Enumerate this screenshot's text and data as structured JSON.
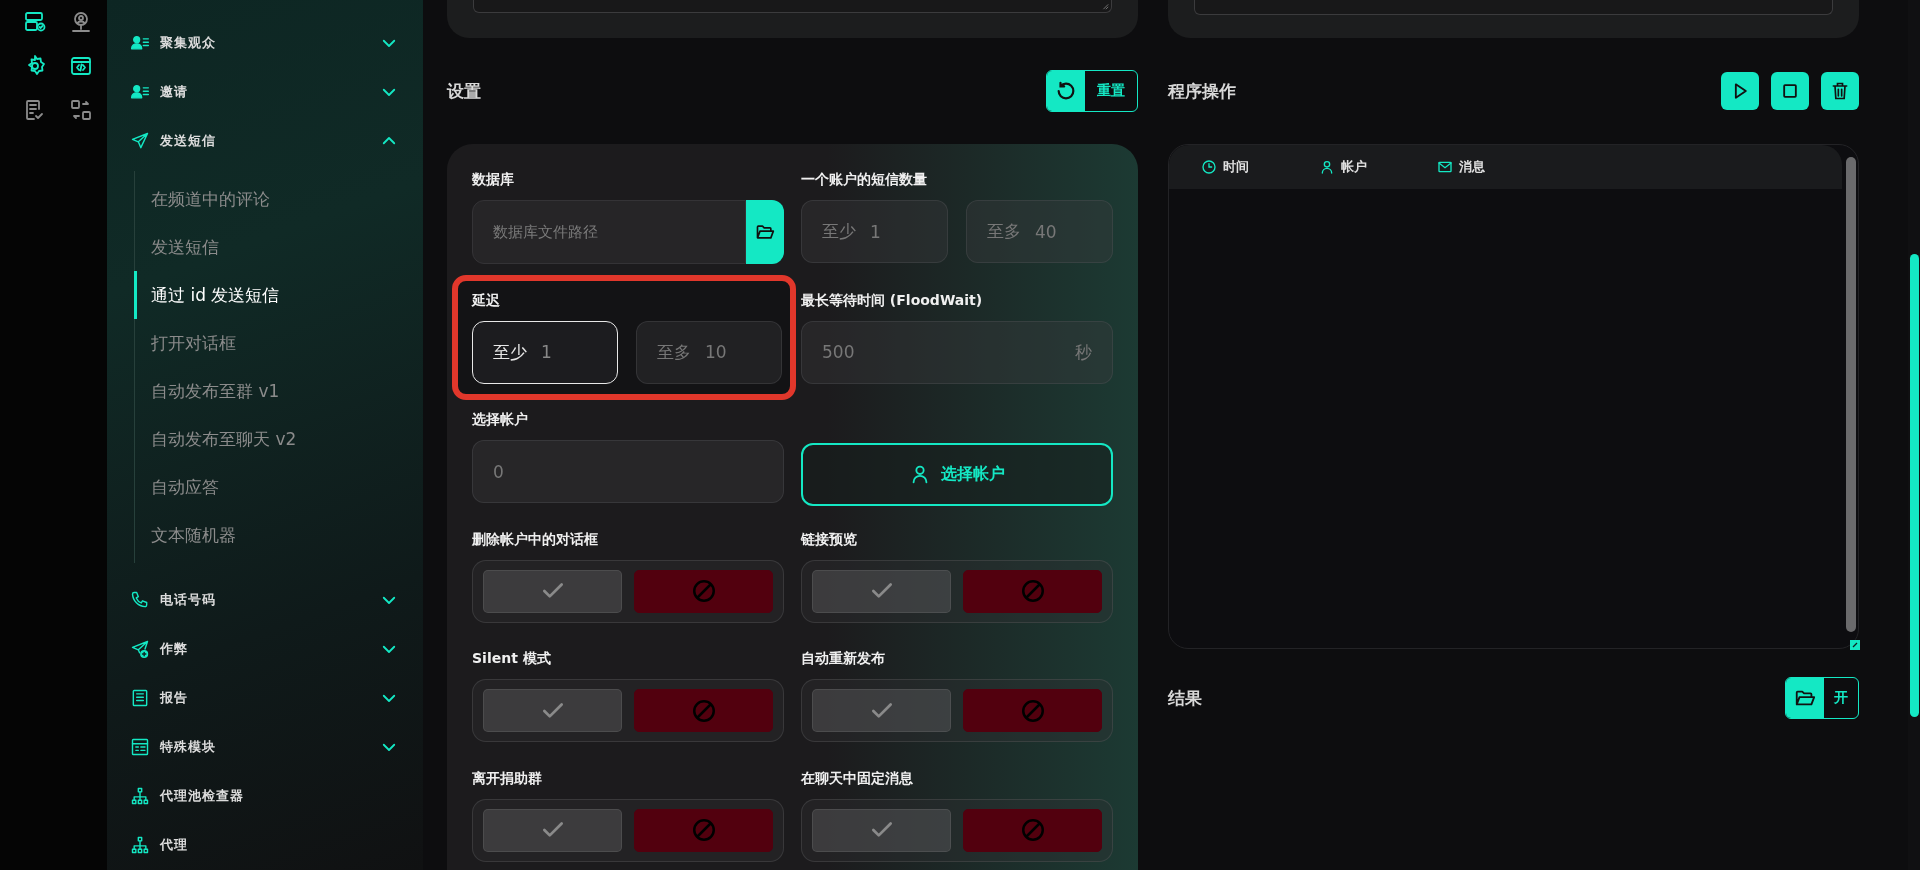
{
  "rail": [
    {
      "active": true
    },
    {
      "active": false
    },
    {
      "active": true
    },
    {
      "active": true
    },
    {
      "active": false
    },
    {
      "active": false
    }
  ],
  "sidebar": {
    "groups": [
      {
        "label": "聚集观众",
        "expanded": false
      },
      {
        "label": "邀请",
        "expanded": false
      },
      {
        "label": "发送短信",
        "expanded": true,
        "children": [
          {
            "label": "在频道中的评论",
            "selected": false
          },
          {
            "label": "发送短信",
            "selected": false
          },
          {
            "label": "通过 id 发送短信",
            "selected": true
          },
          {
            "label": "打开对话框",
            "selected": false
          },
          {
            "label": "自动发布至群 v1",
            "selected": false
          },
          {
            "label": "自动发布至聊天 v2",
            "selected": false
          },
          {
            "label": "自动应答",
            "selected": false
          },
          {
            "label": "文本随机器",
            "selected": false
          }
        ]
      },
      {
        "label": "电话号码",
        "expanded": false
      },
      {
        "label": "作弊",
        "expanded": false
      },
      {
        "label": "报告",
        "expanded": false
      },
      {
        "label": "特殊模块",
        "expanded": false
      },
      {
        "label": "代理池检查器"
      },
      {
        "label": "代理"
      }
    ]
  },
  "settings": {
    "title": "设置",
    "reset_button": "重置",
    "database": {
      "label": "数据库",
      "placeholder": "数据库文件路径"
    },
    "messages_per_account": {
      "label": "一个账户的短信数量",
      "min": {
        "prefix": "至少",
        "value": "1",
        "focused": false
      },
      "max": {
        "prefix": "至多",
        "value": "40",
        "focused": false
      }
    },
    "delay": {
      "label": "延迟",
      "highlighted": true,
      "min": {
        "prefix": "至少",
        "value": "1",
        "focused": true
      },
      "max": {
        "prefix": "至多",
        "value": "10",
        "focused": false
      }
    },
    "flood_wait": {
      "label": "最长等待时间 (FloodWait)",
      "value": "500",
      "suffix": "秒"
    },
    "accounts": {
      "label": "选择帐户",
      "value": "0",
      "button": "选择帐户"
    },
    "toggles": [
      {
        "label": "删除帐户中的对话框",
        "on": false
      },
      {
        "label": "链接预览",
        "on": false
      },
      {
        "label": "Silent 模式",
        "on": false
      },
      {
        "label": "自动重新发布",
        "on": false
      },
      {
        "label": "离开捐助群",
        "on": false
      },
      {
        "label": "在聊天中固定消息",
        "on": false
      }
    ]
  },
  "program": {
    "title": "程序操作",
    "log_columns": [
      "时间",
      "帐户",
      "消息"
    ]
  },
  "results": {
    "title": "结果",
    "open_button": "开"
  }
}
